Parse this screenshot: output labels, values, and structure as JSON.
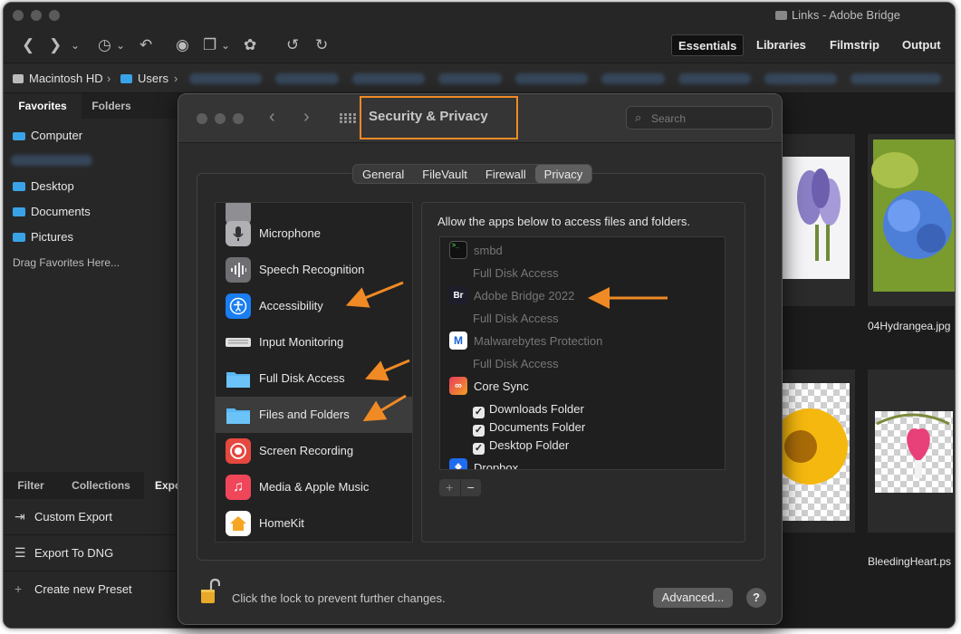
{
  "bridge": {
    "window_title": "Links - Adobe Bridge",
    "workspaces": [
      "Essentials",
      "Libraries",
      "Filmstrip",
      "Output"
    ],
    "path": [
      "Macintosh HD",
      "Users"
    ],
    "left_tabs": [
      "Favorites",
      "Folders"
    ],
    "favorites": [
      "Computer",
      "Desktop",
      "Documents",
      "Pictures"
    ],
    "drag_hint": "Drag Favorites Here...",
    "bottom_tabs": [
      "Filter",
      "Collections",
      "Expo"
    ],
    "export_items": [
      "Custom Export",
      "Export To DNG",
      "Create new Preset"
    ],
    "thumb_labels": [
      "04Hydrangea.jpg",
      "BleedingHeart.ps"
    ]
  },
  "sp": {
    "title": "Security & Privacy",
    "search_placeholder": "Search",
    "tabs": [
      "General",
      "FileVault",
      "Firewall",
      "Privacy"
    ],
    "active_tab": "Privacy",
    "sidebar": [
      {
        "label": "Microphone",
        "icon": "microphone-icon",
        "color": "#8e8e93"
      },
      {
        "label": "Speech Recognition",
        "icon": "waveform-icon",
        "color": "#6e6e73"
      },
      {
        "label": "Accessibility",
        "icon": "accessibility-icon",
        "color": "#1a7ef2"
      },
      {
        "label": "Input Monitoring",
        "icon": "keyboard-icon",
        "color": "#d9d9d9"
      },
      {
        "label": "Full Disk Access",
        "icon": "folder-icon",
        "color": "#5ab8f5"
      },
      {
        "label": "Files and Folders",
        "icon": "folder-icon",
        "color": "#5ab8f5"
      },
      {
        "label": "Screen Recording",
        "icon": "record-icon",
        "color": "#e5483f"
      },
      {
        "label": "Media & Apple Music",
        "icon": "music-note-icon",
        "color": "#f0465a"
      },
      {
        "label": "HomeKit",
        "icon": "home-icon",
        "color": "#ffffff"
      }
    ],
    "selected_sidebar": "Files and Folders",
    "description": "Allow the apps below to access files and folders.",
    "apps": [
      {
        "name": "smbd",
        "sub": "Full Disk Access"
      },
      {
        "name": "Adobe Bridge 2022",
        "sub": "Full Disk Access",
        "icon_text": "Br"
      },
      {
        "name": "Malwarebytes Protection",
        "sub": "Full Disk Access"
      },
      {
        "name": "Core Sync"
      },
      {
        "name": "Dropbox"
      }
    ],
    "core_sync_folders": [
      "Downloads Folder",
      "Documents Folder",
      "Desktop Folder"
    ],
    "plus": "+",
    "minus": "−",
    "lock_text": "Click the lock to prevent further changes.",
    "advanced_label": "Advanced...",
    "help_label": "?",
    "accent": "#f08a24"
  }
}
